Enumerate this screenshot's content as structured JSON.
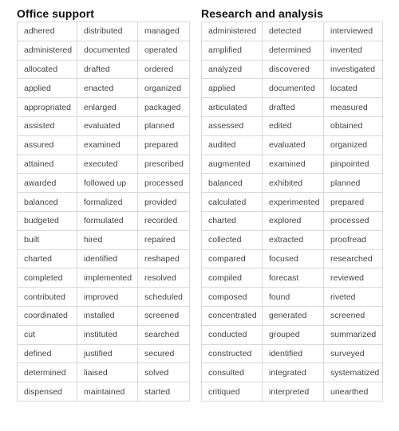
{
  "sections": [
    {
      "title": "Office support",
      "rows": [
        [
          "adhered",
          "distributed",
          "managed"
        ],
        [
          "administered",
          "documented",
          "operated"
        ],
        [
          "allocated",
          "drafted",
          "ordered"
        ],
        [
          "applied",
          "enacted",
          "organized"
        ],
        [
          "appropriated",
          "enlarged",
          "packaged"
        ],
        [
          "assisted",
          "evaluated",
          "planned"
        ],
        [
          "assured",
          "examined",
          "prepared"
        ],
        [
          "attained",
          "executed",
          "prescribed"
        ],
        [
          "awarded",
          "followed up",
          "processed"
        ],
        [
          "balanced",
          "formalized",
          "provided"
        ],
        [
          "budgeted",
          "formulated",
          "recorded"
        ],
        [
          "built",
          "hired",
          "repaired"
        ],
        [
          "charted",
          "identified",
          "reshaped"
        ],
        [
          "completed",
          "implemented",
          "resolved"
        ],
        [
          "contributed",
          "improved",
          "scheduled"
        ],
        [
          "coordinated",
          "installed",
          "screened"
        ],
        [
          "cut",
          "instituted",
          "searched"
        ],
        [
          "defined",
          "justified",
          "secured"
        ],
        [
          "determined",
          "liaised",
          "solved"
        ],
        [
          "dispensed",
          "maintained",
          "started"
        ]
      ]
    },
    {
      "title": "Research and analysis",
      "rows": [
        [
          "administered",
          "detected",
          "interviewed"
        ],
        [
          "amplified",
          "determined",
          "invented"
        ],
        [
          "analyzed",
          "discovered",
          "investigated"
        ],
        [
          "applied",
          "documented",
          "located"
        ],
        [
          "articulated",
          "drafted",
          "measured"
        ],
        [
          "assessed",
          "edited",
          "obtained"
        ],
        [
          "audited",
          "evaluated",
          "organized"
        ],
        [
          "augmented",
          "examined",
          "pinpointed"
        ],
        [
          "balanced",
          "exhibited",
          "planned"
        ],
        [
          "calculated",
          "experimented",
          "prepared"
        ],
        [
          "charted",
          "explored",
          "processed"
        ],
        [
          "collected",
          "extracted",
          "proofread"
        ],
        [
          "compared",
          "focused",
          "researched"
        ],
        [
          "compiled",
          "forecast",
          "reviewed"
        ],
        [
          "composed",
          "found",
          "riveted"
        ],
        [
          "concentrated",
          "generated",
          "screened"
        ],
        [
          "conducted",
          "grouped",
          "summarized"
        ],
        [
          "constructed",
          "identified",
          "surveyed"
        ],
        [
          "consulted",
          "integrated",
          "systematized"
        ],
        [
          "critiqued",
          "interpreted",
          "unearthed"
        ]
      ]
    }
  ]
}
